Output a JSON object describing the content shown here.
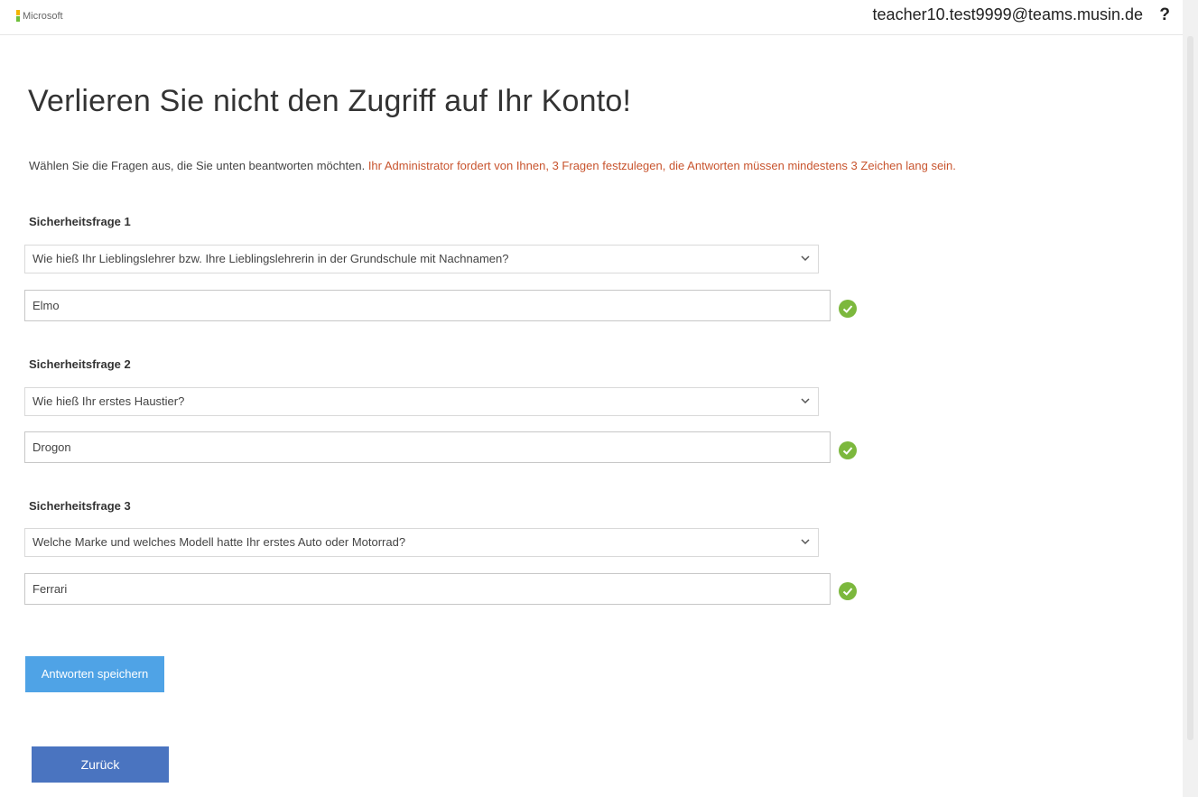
{
  "header": {
    "brand": "Microsoft",
    "user_email": "teacher10.test9999@teams.musin.de",
    "help": "?"
  },
  "page": {
    "title": "Verlieren Sie nicht den Zugriff auf Ihr Konto!",
    "intro": "Wählen Sie die Fragen aus, die Sie unten beantworten möchten.",
    "warning": "Ihr Administrator fordert von Ihnen, 3 Fragen festzulegen, die Antworten müssen mindestens 3 Zeichen lang sein."
  },
  "questions": [
    {
      "label": "Sicherheitsfrage 1",
      "selected": "Wie hieß Ihr Lieblingslehrer bzw. Ihre Lieblingslehrerin in der Grundschule mit Nachnamen?",
      "answer": "Elmo"
    },
    {
      "label": "Sicherheitsfrage 2",
      "selected": "Wie hieß Ihr erstes Haustier?",
      "answer": "Drogon"
    },
    {
      "label": "Sicherheitsfrage 3",
      "selected": "Welche Marke und welches Modell hatte Ihr erstes Auto oder Motorrad?",
      "answer": "Ferrari"
    }
  ],
  "buttons": {
    "save": "Antworten speichern",
    "back": "Zurück"
  },
  "colors": {
    "warning": "#c8542e",
    "save_button": "#4fa3e6",
    "back_button": "#4a74c0",
    "check": "#7cb83d"
  },
  "icons": {
    "dropdown": "chevron-down-icon",
    "valid": "checkmark-circle-icon"
  }
}
